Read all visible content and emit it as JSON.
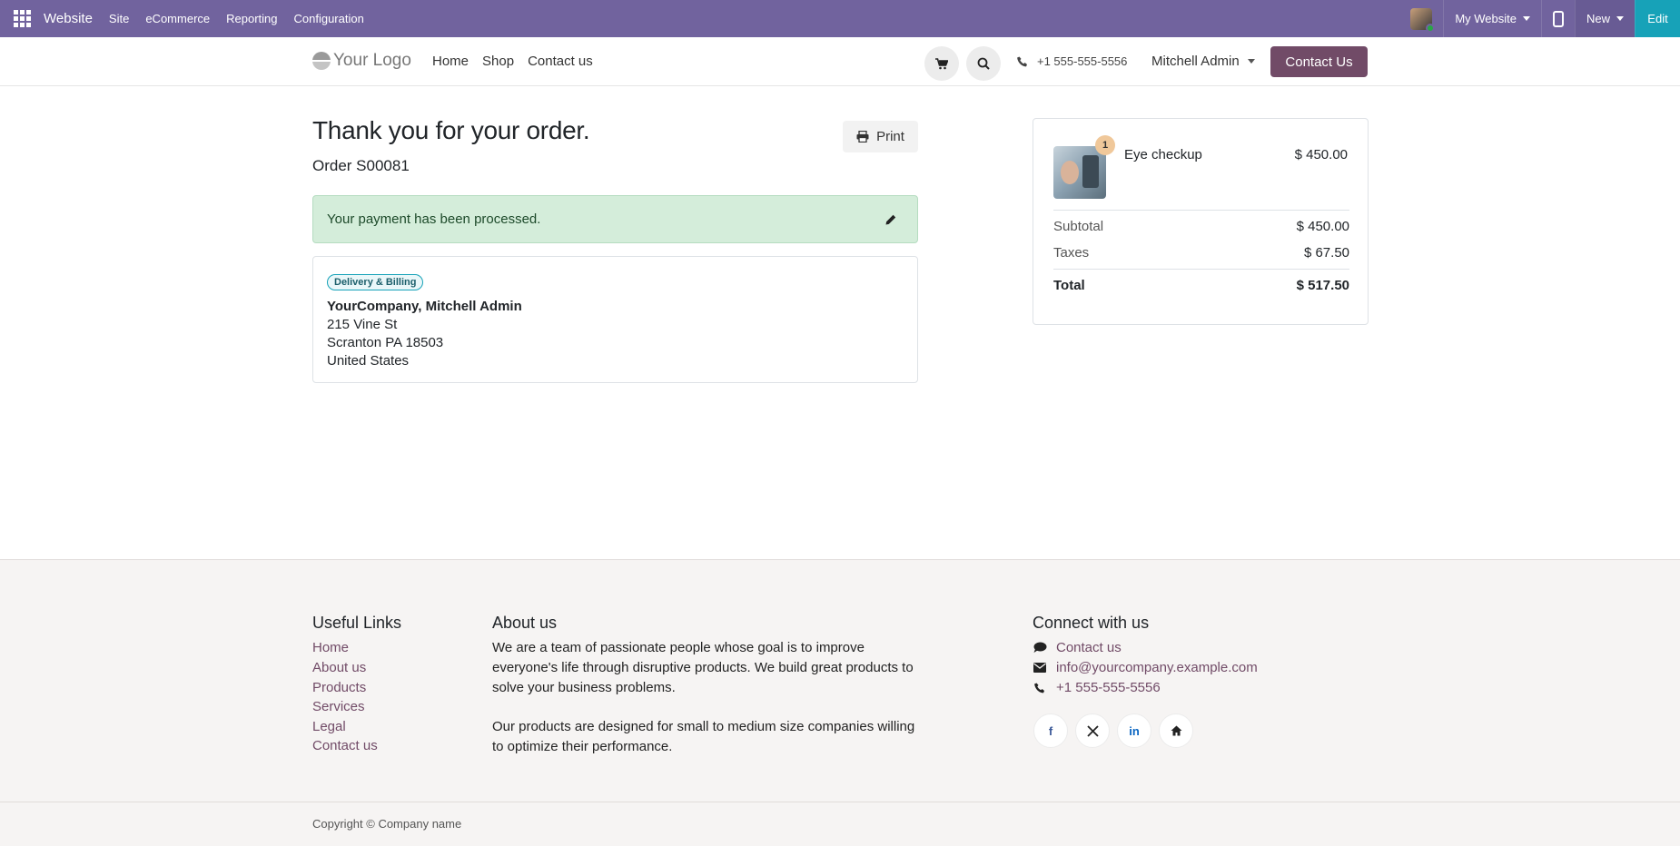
{
  "adminbar": {
    "brand": "Website",
    "menus": [
      "Site",
      "eCommerce",
      "Reporting",
      "Configuration"
    ],
    "website_switch": "My Website",
    "new_label": "New",
    "edit_label": "Edit"
  },
  "header": {
    "logo_text": "Your Logo",
    "nav": [
      "Home",
      "Shop",
      "Contact us"
    ],
    "phone": "+1 555-555-5556",
    "user": "Mitchell Admin",
    "cta": "Contact Us"
  },
  "main": {
    "title": "Thank you for your order.",
    "order_number": "Order S00081",
    "print_label": "Print",
    "alert": "Your payment has been processed.",
    "address": {
      "badge": "Delivery & Billing",
      "name": "YourCompany, Mitchell Admin",
      "lines": [
        "215 Vine St",
        "Scranton PA 18503",
        "United States"
      ]
    }
  },
  "summary": {
    "product": {
      "name": "Eye checkup",
      "price": "$ 450.00",
      "qty": "1"
    },
    "subtotal_label": "Subtotal",
    "subtotal": "$ 450.00",
    "taxes_label": "Taxes",
    "taxes": "$ 67.50",
    "total_label": "Total",
    "total": "$ 517.50"
  },
  "footer": {
    "useful_links_title": "Useful Links",
    "useful_links": [
      "Home",
      "About us",
      "Products",
      "Services",
      "Legal",
      "Contact us"
    ],
    "about_title": "About us",
    "about_p1": "We are a team of passionate people whose goal is to improve everyone's life through disruptive products. We build great products to solve your business problems.",
    "about_p2": "Our products are designed for small to medium size companies willing to optimize their performance.",
    "connect_title": "Connect with us",
    "connect": {
      "contact": "Contact us",
      "email": "info@yourcompany.example.com",
      "phone": "+1 555-555-5556"
    },
    "social_icons": [
      "facebook-icon",
      "x-icon",
      "linkedin-icon",
      "home-icon"
    ],
    "copyright": "Copyright © Company name"
  },
  "colors": {
    "admin_bar": "#71639e",
    "primary": "#714b67",
    "edit": "#17a2b8",
    "alert_bg": "#d4edda"
  }
}
